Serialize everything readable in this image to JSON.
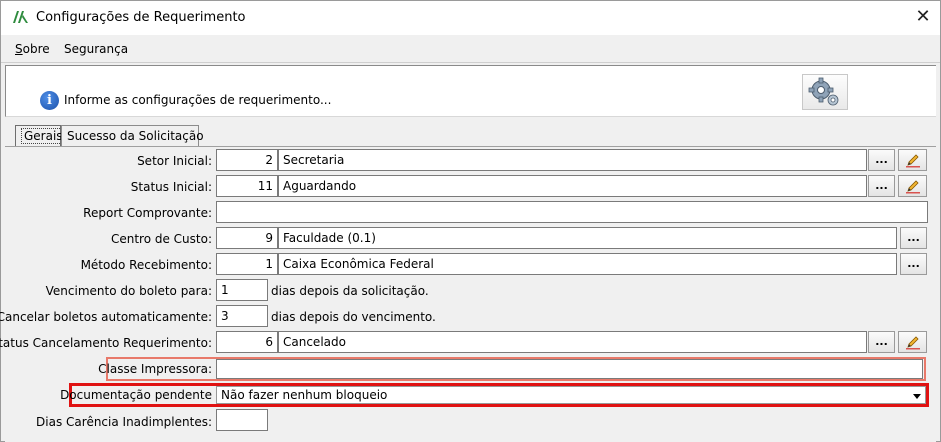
{
  "window": {
    "title": "Configurações de Requerimento",
    "close_symbol": "✕"
  },
  "menu": {
    "items": [
      {
        "label_first": "S",
        "label_rest": "obre"
      },
      {
        "label": "Segurança"
      }
    ]
  },
  "header": {
    "info_text": "Informe as configurações de requerimento...",
    "info_symbol": "i",
    "gear_icon": "gear-icon"
  },
  "tabs": [
    {
      "label": "Gerais",
      "active": true
    },
    {
      "label": "Sucesso da Solicitação",
      "active": false
    }
  ],
  "form": {
    "setor_inicial": {
      "label": "Setor Inicial:",
      "code": "2",
      "value": "Secretaria"
    },
    "status_inicial": {
      "label": "Status Inicial:",
      "code": "11",
      "value": "Aguardando"
    },
    "report_comprovante": {
      "label": "Report Comprovante:",
      "value": ""
    },
    "centro_custo": {
      "label": "Centro de Custo:",
      "code": "9",
      "value": "Faculdade (0.1)"
    },
    "metodo_recebimento": {
      "label": "Método Recebimento:",
      "code": "1",
      "value": "Caixa Econômica Federal"
    },
    "vencimento_boleto": {
      "label": "Vencimento do boleto para:",
      "value": "1",
      "suffix": "dias depois da solicitação."
    },
    "cancelar_boletos": {
      "label": "Cancelar boletos automaticamente:",
      "value": "3",
      "suffix": "dias depois do vencimento."
    },
    "status_cancelamento": {
      "label": "Status Cancelamento Requerimento:",
      "code": "6",
      "value": "Cancelado"
    },
    "classe_impressora": {
      "label": "Classe Impressora:",
      "value": ""
    },
    "documentacao_pendente": {
      "label": "Documentação pendente",
      "value": "Não fazer nenhum bloqueio"
    },
    "dias_carencia": {
      "label": "Dias Carência Inadimplentes:",
      "value": ""
    }
  },
  "buttons": {
    "dots_label": "..."
  },
  "colors": {
    "highlight_orange": "#e8796a",
    "highlight_red": "#e01212",
    "info_blue": "#1a4fa8"
  }
}
